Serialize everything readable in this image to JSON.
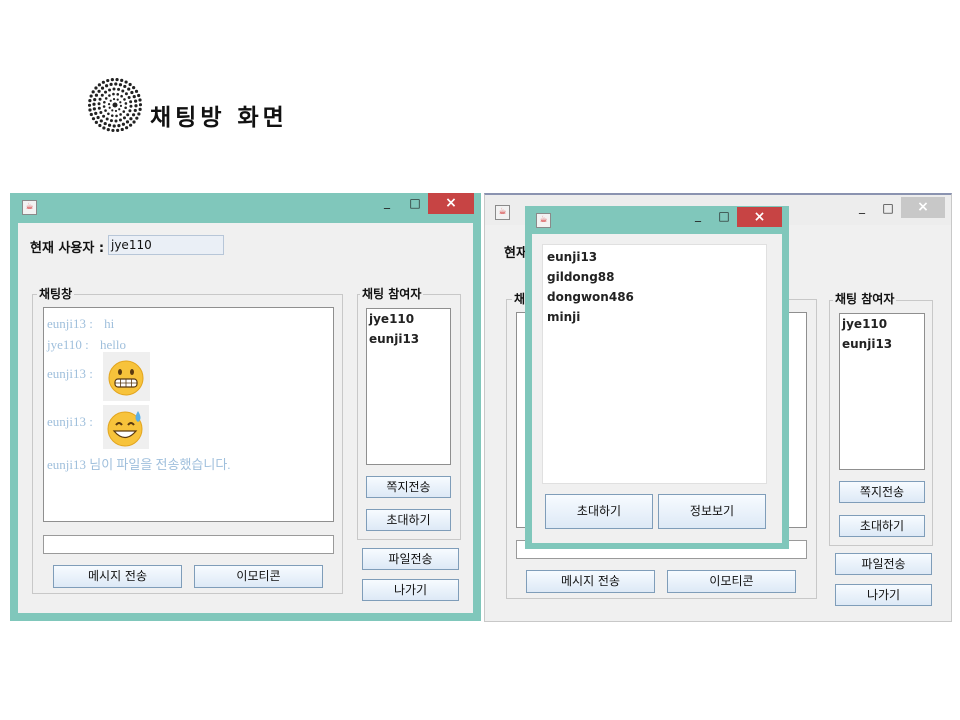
{
  "page": {
    "title": "채팅방 화면"
  },
  "window1": {
    "app_icon": "java-icon",
    "controls": {
      "minimize": "_",
      "maximize": "□",
      "close": "×"
    },
    "current_user": {
      "label": "현재 사용자 :",
      "value": "jye110"
    },
    "chat_area": {
      "legend": "채팅창",
      "messages": [
        {
          "sender": "eunji13 :",
          "text": "hi"
        },
        {
          "sender": "jye110 :",
          "text": "hello"
        },
        {
          "sender": "eunji13 :",
          "emoticon": "grimacing-emoji"
        },
        {
          "sender": "eunji13 :",
          "emoticon": "sweat-smile-emoji"
        },
        {
          "text": "eunji13 님이 파일을 전송했습니다."
        }
      ],
      "input_value": ""
    },
    "buttons": {
      "send": "메시지 전송",
      "emoticon": "이모티콘"
    },
    "participants": {
      "legend": "채팅 참여자",
      "items": [
        "jye110",
        "eunji13"
      ],
      "note_button": "쪽지전송",
      "invite_button": "초대하기"
    },
    "file_button": "파일전송",
    "exit_button": "나가기"
  },
  "window2": {
    "current_user_label": "현재",
    "chat_legend": "채",
    "participants": {
      "legend": "채팅 참여자",
      "items": [
        "jye110",
        "eunji13"
      ],
      "note_button": "쪽지전송",
      "invite_button": "초대하기"
    },
    "buttons": {
      "send": "메시지 전송",
      "emoticon": "이모티콘"
    },
    "file_button": "파일전송",
    "exit_button": "나가기"
  },
  "invite_dialog": {
    "users": [
      "eunji13",
      "gildong88",
      "dongwon486",
      "minji"
    ],
    "buttons": {
      "invite": "초대하기",
      "info": "정보보기"
    }
  },
  "colors": {
    "frame": "#80c7bb",
    "close": "#c74444",
    "chat_text": "#9fbfdc"
  }
}
